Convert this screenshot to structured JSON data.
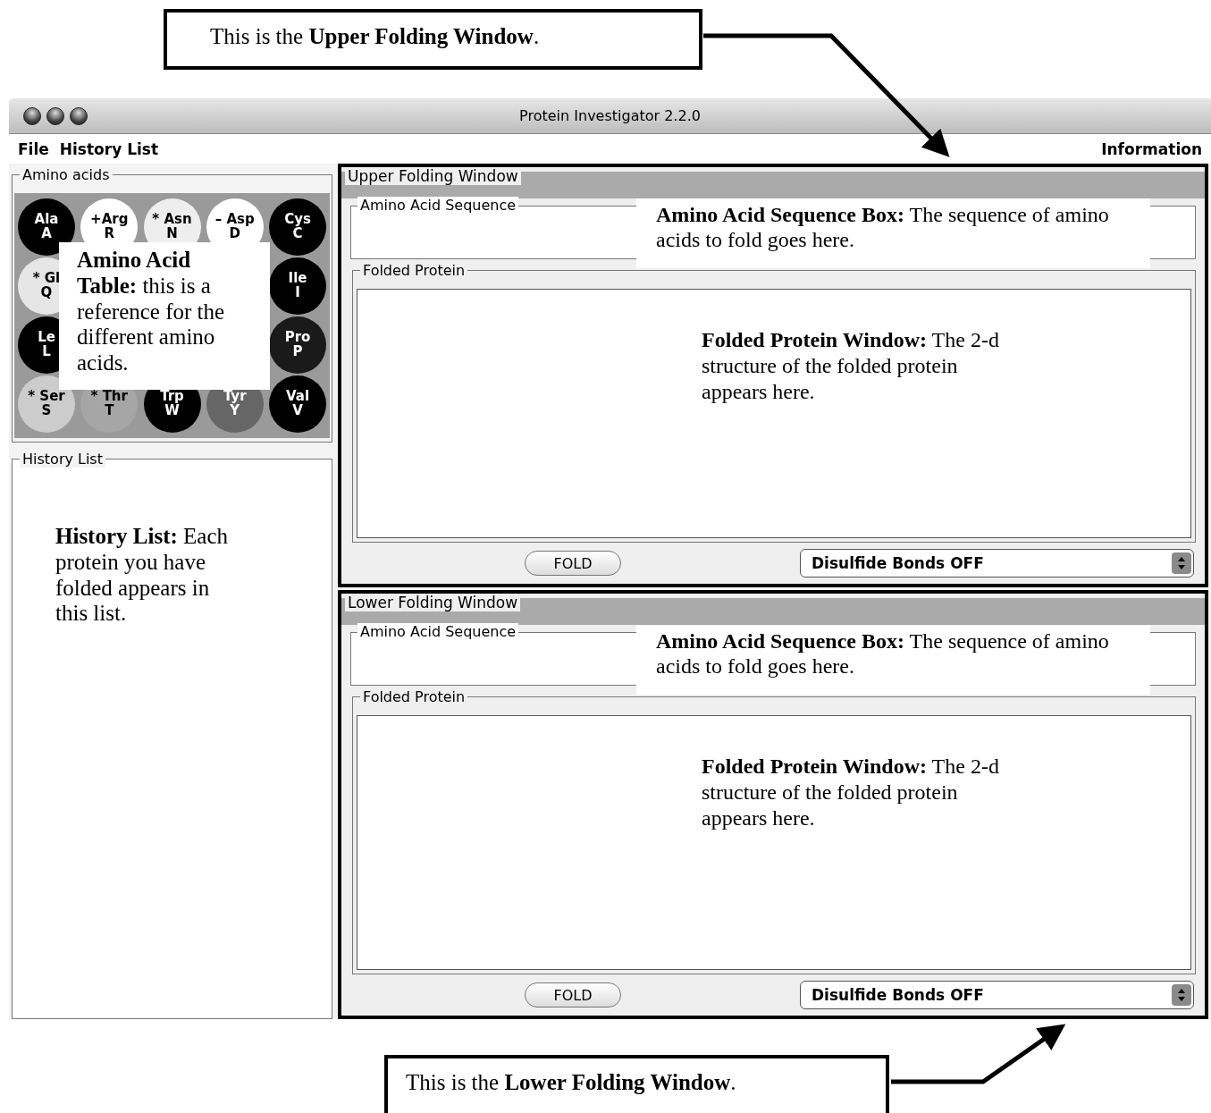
{
  "annotations": {
    "top": "This is the **Upper Folding Window**.",
    "bottom": "This is the **Lower Folding Window**."
  },
  "window": {
    "title": "Protein Investigator 2.2.0"
  },
  "menu": {
    "left": [
      "File",
      "History List"
    ],
    "right": [
      "Information"
    ]
  },
  "amino_acids": {
    "title": "Amino acids",
    "note": "**Amino Acid Table:** this is a reference for the different amino acids.",
    "rows": [
      [
        {
          "name": "Ala",
          "letter": "A",
          "color": "#000000"
        },
        {
          "name": "+Arg",
          "letter": "R",
          "color": "#ffffff"
        },
        {
          "name": "* Asn",
          "letter": "N",
          "color": "#eeeeee"
        },
        {
          "name": "– Asp",
          "letter": "D",
          "color": "#ffffff"
        },
        {
          "name": "Cys",
          "letter": "C",
          "color": "#000000"
        }
      ],
      [
        {
          "name": "* Gl",
          "letter": "Q",
          "color": "#e6e6e6"
        },
        {
          "name": "Ile",
          "letter": "I",
          "color": "#000000"
        }
      ],
      [
        {
          "name": "Le",
          "letter": "L",
          "color": "#000000"
        },
        {
          "name": "Pro",
          "letter": "P",
          "color": "#1a1a1a"
        }
      ],
      [
        {
          "name": "* Ser",
          "letter": "S",
          "color": "#cccccc"
        },
        {
          "name": "* Thr",
          "letter": "T",
          "color": "#a6a6a6"
        },
        {
          "name": "Trp",
          "letter": "W",
          "color": "#000000"
        },
        {
          "name": "Tyr",
          "letter": "Y",
          "color": "#666666"
        },
        {
          "name": "Val",
          "letter": "V",
          "color": "#000000"
        }
      ]
    ]
  },
  "history_list": {
    "title": "History List",
    "note": "**History List:** Each protein you have folded appears in this list."
  },
  "folding_windows": [
    {
      "title": "Upper Folding Window",
      "sequence_label": "Amino Acid Sequence",
      "sequence_note": "**Amino Acid Sequence Box:** The sequence of amino acids to fold goes here.",
      "folded_label": "Folded Protein",
      "folded_note": "**Folded Protein Window:** The 2-d structure of the folded protein appears here.",
      "fold_button": "FOLD",
      "bonds_select": "Disulfide Bonds OFF"
    },
    {
      "title": "Lower Folding Window",
      "sequence_label": "Amino Acid Sequence",
      "sequence_note": "**Amino Acid Sequence Box:** The sequence of amino acids to fold goes here.",
      "folded_label": "Folded Protein",
      "folded_note": "**Folded Protein Window:** The 2-d structure of the folded protein appears here.",
      "fold_button": "FOLD",
      "bonds_select": "Disulfide Bonds OFF"
    }
  ]
}
